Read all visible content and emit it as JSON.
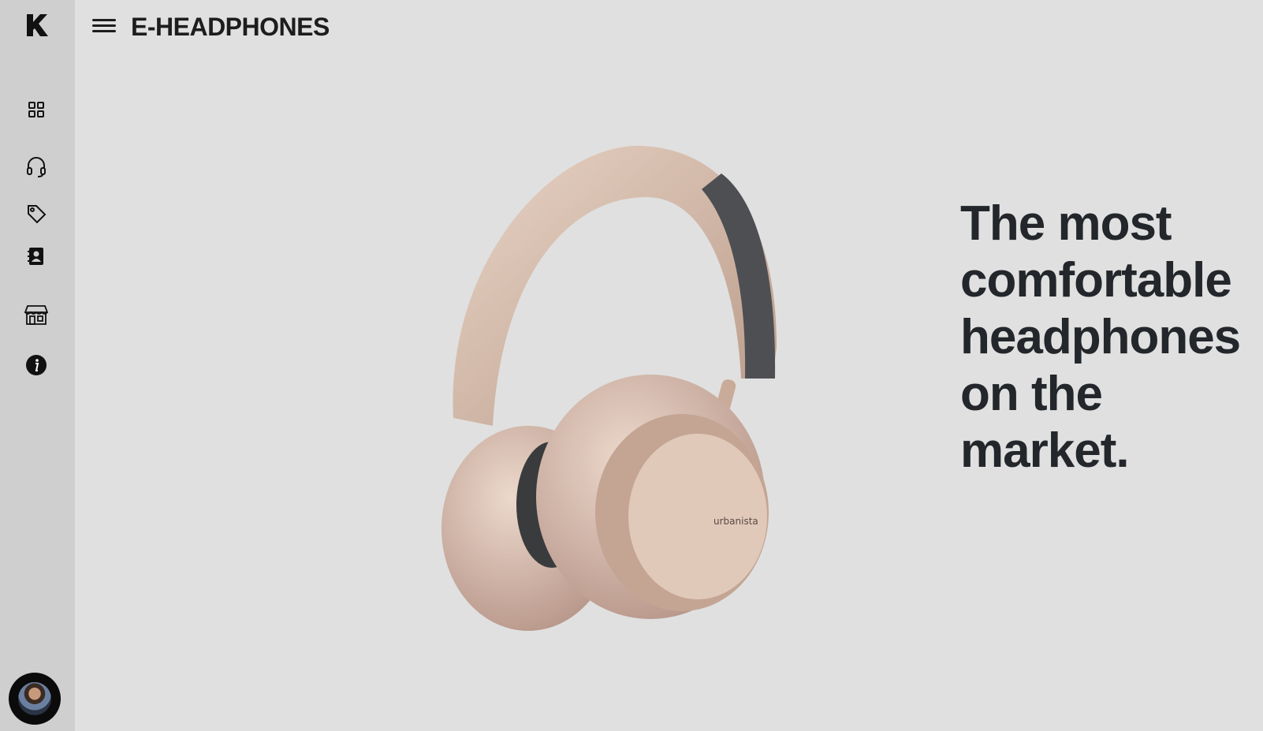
{
  "header": {
    "title": "E-HEADPHONES",
    "menu_icon": "hamburger-menu-icon"
  },
  "sidebar": {
    "logo_icon": "k-logo-icon",
    "items": [
      {
        "icon": "grid-icon"
      },
      {
        "icon": "headphones-icon"
      },
      {
        "icon": "tag-icon"
      },
      {
        "icon": "contact-book-icon"
      },
      {
        "icon": "store-icon"
      },
      {
        "icon": "info-icon"
      }
    ],
    "avatar_icon": "user-avatar"
  },
  "hero": {
    "image": "headphones-product-image",
    "brand_mark": "urbanista",
    "headline": "The most comfortable headphones on the market."
  },
  "colors": {
    "background": "#e0e0e0",
    "sidebar": "#cfcfcf",
    "text": "#23272b",
    "headphones": "#d4b7a6"
  }
}
